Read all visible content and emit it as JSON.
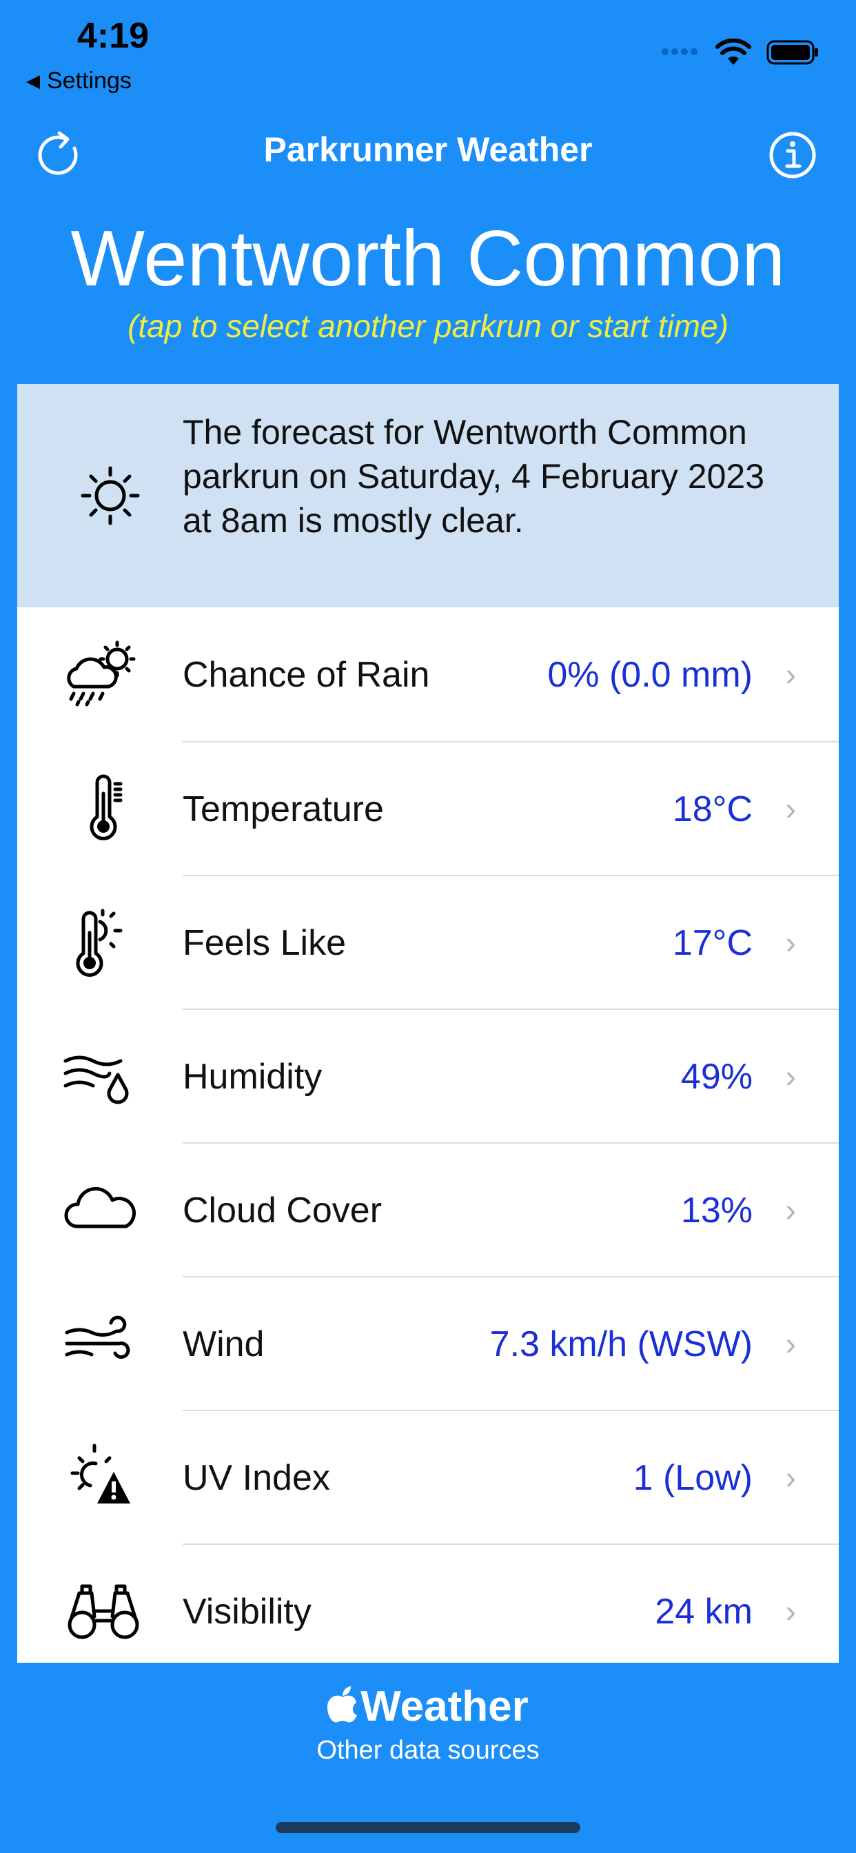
{
  "status_bar": {
    "time": "4:19",
    "back_label": "Settings"
  },
  "nav": {
    "title": "Parkrunner Weather"
  },
  "location": {
    "name": "Wentworth Common",
    "hint": "(tap to select another parkrun or start time)"
  },
  "summary": {
    "icon": "sun-icon",
    "text": "The forecast for Wentworth Common parkrun on Saturday, 4 February 2023 at 8am is mostly clear."
  },
  "rows": [
    {
      "icon": "sun-cloud-rain-icon",
      "label": "Chance of Rain",
      "value": "0% (0.0 mm)"
    },
    {
      "icon": "thermometer-icon",
      "label": "Temperature",
      "value": "18°C"
    },
    {
      "icon": "thermometer-sun-icon",
      "label": "Feels Like",
      "value": "17°C"
    },
    {
      "icon": "humidity-icon",
      "label": "Humidity",
      "value": "49%"
    },
    {
      "icon": "cloud-icon",
      "label": "Cloud Cover",
      "value": "13%"
    },
    {
      "icon": "wind-icon",
      "label": "Wind",
      "value": "7.3 km/h (WSW)"
    },
    {
      "icon": "uv-warning-icon",
      "label": "UV Index",
      "value": "1 (Low)"
    },
    {
      "icon": "binoculars-icon",
      "label": "Visibility",
      "value": "24 km"
    }
  ],
  "footer": {
    "brand": "Weather",
    "other_sources": "Other data sources"
  },
  "colors": {
    "background": "#1b8ef7",
    "hint": "#f2ee3f",
    "value": "#1a2fd6",
    "summary_bg": "#cfe1f3"
  }
}
